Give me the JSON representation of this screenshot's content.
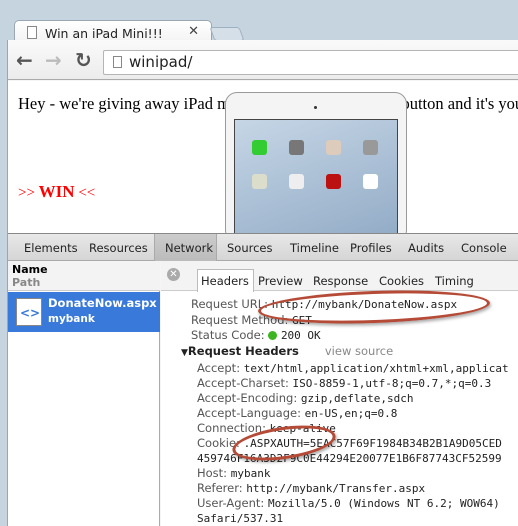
{
  "browser": {
    "tab_title": "Win an iPad Mini!!!",
    "url": "winipad/"
  },
  "page": {
    "intro": "Hey - we're giving away iPad minis!!! Just click the WIN button and it's yours!!!",
    "win_prefix": ">> ",
    "win_label": "WIN",
    "win_suffix": " <<"
  },
  "devtools": {
    "tabs": [
      "Elements",
      "Resources",
      "Network",
      "Sources",
      "Timeline",
      "Profiles",
      "Audits",
      "Console"
    ],
    "active_tab": "Network",
    "list_header": {
      "name": "Name",
      "path": "Path"
    },
    "request": {
      "name": "DonateNow.aspx",
      "path": "mybank"
    },
    "subtabs": [
      "Headers",
      "Preview",
      "Response",
      "Cookies",
      "Timing"
    ],
    "headers": {
      "url_label": "Request URL:",
      "url": "http://mybank/DonateNow.aspx",
      "method_label": "Request Method:",
      "method": "GET",
      "status_label": "Status Code:",
      "status": "200 OK",
      "status_color": "#3cb521",
      "req_headers_label": "Request Headers",
      "view_source": "view source",
      "accept": "Accept:",
      "accept_v": "text/html,application/xhtml+xml,applicat",
      "charset": "Accept-Charset:",
      "charset_v": "ISO-8859-1,utf-8;q=0.7,*;q=0.3",
      "encoding": "Accept-Encoding:",
      "encoding_v": "gzip,deflate,sdch",
      "language": "Accept-Language:",
      "language_v": "en-US,en;q=0.8",
      "connection": "Connection:",
      "connection_v": "keep-alive",
      "cookie": "Cookie:",
      "cookie_v1": ".ASPXAUTH=5EAC57F69F1984B34B2B1A9D05CED",
      "cookie_v2": "459746F16A3D2F9C0E44294E20077E1B6F87743CF52599",
      "host": "Host:",
      "host_v": "mybank",
      "referer": "Referer:",
      "referer_v": "http://mybank/Transfer.aspx",
      "ua": "User-Agent:",
      "ua_v1": "Mozilla/5.0 (Windows NT 6.2; WOW64)",
      "ua_v2": "Safari/537.31"
    }
  },
  "annotation_color": "#b54a36"
}
